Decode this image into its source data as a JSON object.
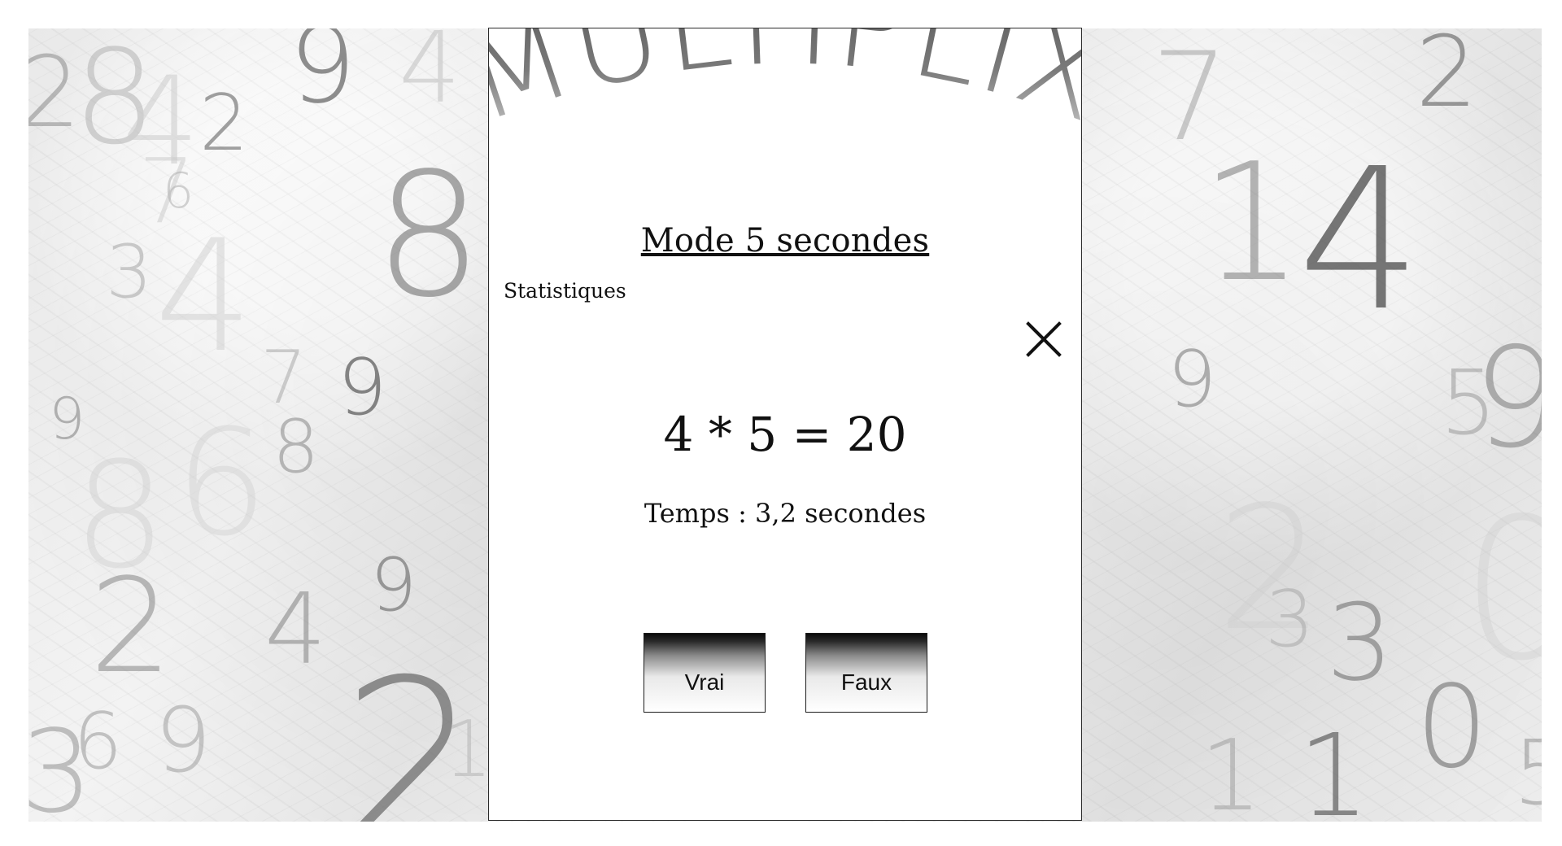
{
  "app": {
    "logo_text": "MULTIPLIX"
  },
  "mode": {
    "title": "Mode 5 secondes"
  },
  "navigation": {
    "stats_label": "Statistiques",
    "close_icon": "close-icon"
  },
  "question": {
    "text": "4 * 5 = 20"
  },
  "timer": {
    "text": "Temps : 3,2 secondes"
  },
  "buttons": {
    "true_label": "Vrai",
    "false_label": "Faux"
  },
  "colors": {
    "panel_bg": "#ffffff",
    "text": "#111111"
  },
  "background": {
    "digits": [
      "2",
      "8",
      "4",
      "2",
      "9",
      "4",
      "7",
      "6",
      "8",
      "3",
      "4",
      "9",
      "8",
      "7",
      "9",
      "8",
      "6",
      "2",
      "9",
      "4",
      "6",
      "9",
      "3",
      "2",
      "1",
      "7",
      "2",
      "1",
      "4",
      "9",
      "5",
      "9",
      "3",
      "2",
      "3",
      "0",
      "1",
      "1",
      "0",
      "5"
    ]
  }
}
